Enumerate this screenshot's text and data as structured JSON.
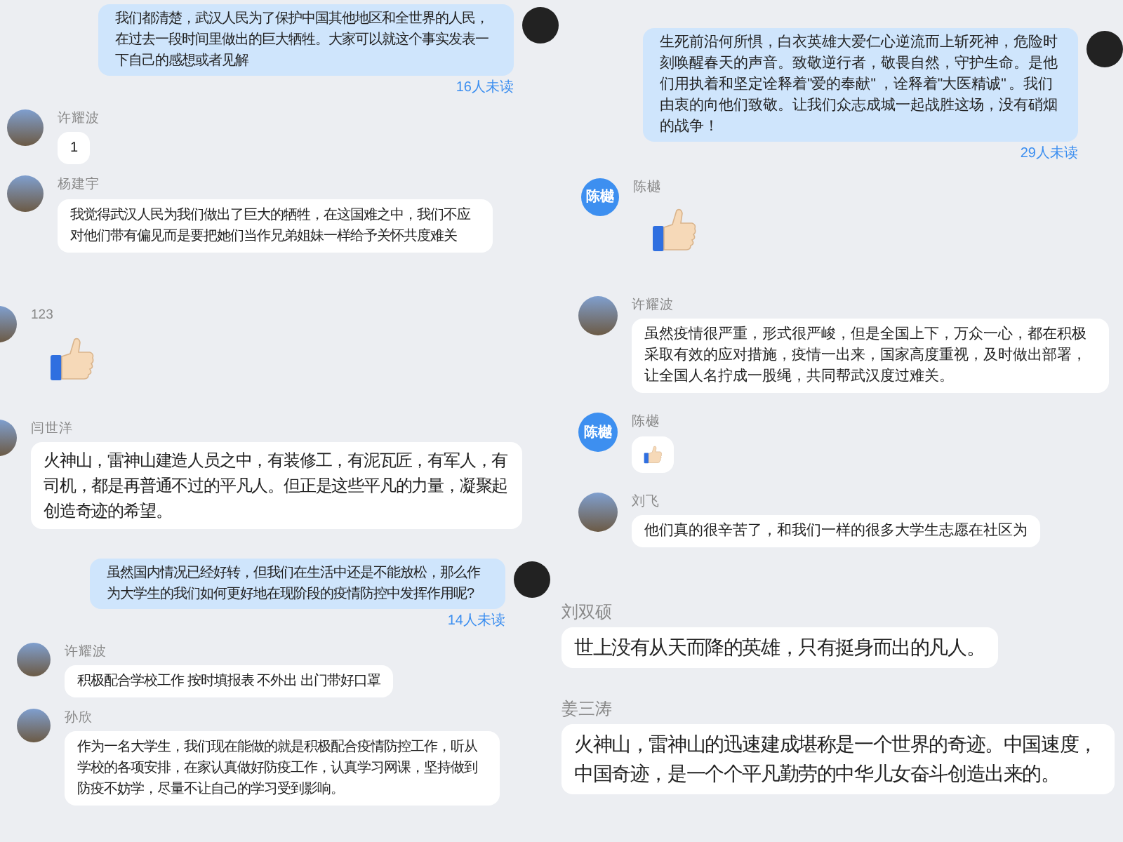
{
  "columns": [
    {
      "panels": [
        {
          "messages": [
            {
              "kind": "outgoing",
              "text": "我们都清楚，武汉人民为了保护中国其他地区和全世界的人民，在过去一段时间里做出的巨大牺牲。大家可以就这个事实发表一下自己的感想或者见解",
              "unread": "16人未读"
            },
            {
              "kind": "incoming",
              "sender": "许耀波",
              "avatar": {
                "kind": "photo"
              },
              "content": {
                "kind": "text",
                "text": "1"
              }
            },
            {
              "kind": "incoming",
              "sender": "杨建宇",
              "avatar": {
                "kind": "photo"
              },
              "content": {
                "kind": "text",
                "text": "我觉得武汉人民为我们做出了巨大的牺牲，在这国难之中，我们不应对他们带有偏见而是要把她们当作兄弟姐妹一样给予关怀共度难关"
              }
            }
          ]
        },
        {
          "messages": [
            {
              "kind": "incoming",
              "sender": "123",
              "avatar": {
                "kind": "photo"
              },
              "content": {
                "kind": "sticker"
              }
            },
            {
              "kind": "incoming",
              "sender": "闫世洋",
              "avatar": {
                "kind": "photo"
              },
              "content": {
                "kind": "text",
                "text": "火神山，雷神山建造人员之中，有装修工，有泥瓦匠，有军人，有司机，都是再普通不过的平凡人。但正是这些平凡的力量，凝聚起创造奇迹的希望。"
              }
            }
          ]
        },
        {
          "messages": [
            {
              "kind": "outgoing",
              "text": "虽然国内情况已经好转，但我们在生活中还是不能放松，那么作为大学生的我们如何更好地在现阶段的疫情防控中发挥作用呢?",
              "unread": "14人未读"
            },
            {
              "kind": "incoming",
              "sender": "许耀波",
              "avatar": {
                "kind": "photo"
              },
              "content": {
                "kind": "text",
                "text": "积极配合学校工作 按时填报表 不外出 出门带好口罩"
              }
            },
            {
              "kind": "incoming",
              "sender": "孙欣",
              "avatar": {
                "kind": "photo"
              },
              "content": {
                "kind": "text",
                "text": "作为一名大学生，我们现在能做的就是积极配合疫情防控工作，听从学校的各项安排，在家认真做好防疫工作，认真学习网课，坚持做到防疫不妨学，尽量不让自己的学习受到影响。"
              }
            }
          ]
        }
      ]
    },
    {
      "panels": [
        {
          "messages": [
            {
              "kind": "outgoing",
              "text": "生死前沿何所惧，白衣英雄大爱仁心逆流而上斩死神，危险时刻唤醒春天的声音。致敬逆行者，敬畏自然，守护生命。是他们用执着和坚定诠释着\"爱的奉献\" ，诠释着\"大医精诚\" 。我们由衷的向他们致敬。让我们众志成城一起战胜这场，没有硝烟的战争！",
              "unread": "29人未读"
            },
            {
              "kind": "incoming",
              "sender": "陈樾",
              "avatar": {
                "kind": "initials",
                "text": "陈樾"
              },
              "content": {
                "kind": "sticker"
              }
            }
          ]
        },
        {
          "messages": [
            {
              "kind": "incoming",
              "sender": "许耀波",
              "avatar": {
                "kind": "photo"
              },
              "content": {
                "kind": "text",
                "text": "虽然疫情很严重，形式很严峻，但是全国上下，万众一心，都在积极采取有效的应对措施，疫情一出来，国家高度重视，及时做出部署，让全国人名拧成一股绳，共同帮武汉度过难关。"
              }
            },
            {
              "kind": "incoming",
              "sender": "陈樾",
              "avatar": {
                "kind": "initials",
                "text": "陈樾"
              },
              "content": {
                "kind": "emoji"
              }
            },
            {
              "kind": "incoming",
              "sender": "刘飞",
              "avatar": {
                "kind": "photo"
              },
              "content": {
                "kind": "text",
                "text": "他们真的很辛苦了，和我们一样的很多大学生志愿在社区为"
              }
            }
          ]
        },
        {
          "messages": [
            {
              "kind": "incoming",
              "sender": "刘双硕",
              "content": {
                "kind": "text",
                "text": "世上没有从天而降的英雄，只有挺身而出的凡人。"
              }
            },
            {
              "kind": "incoming",
              "sender": "姜三涛",
              "content": {
                "kind": "text",
                "text": "火神山，雷神山的迅速建成堪称是一个世界的奇迹。中国速度，中国奇迹，是一个个平凡勤劳的中华儿女奋斗创造出来的。"
              }
            }
          ]
        }
      ]
    }
  ]
}
